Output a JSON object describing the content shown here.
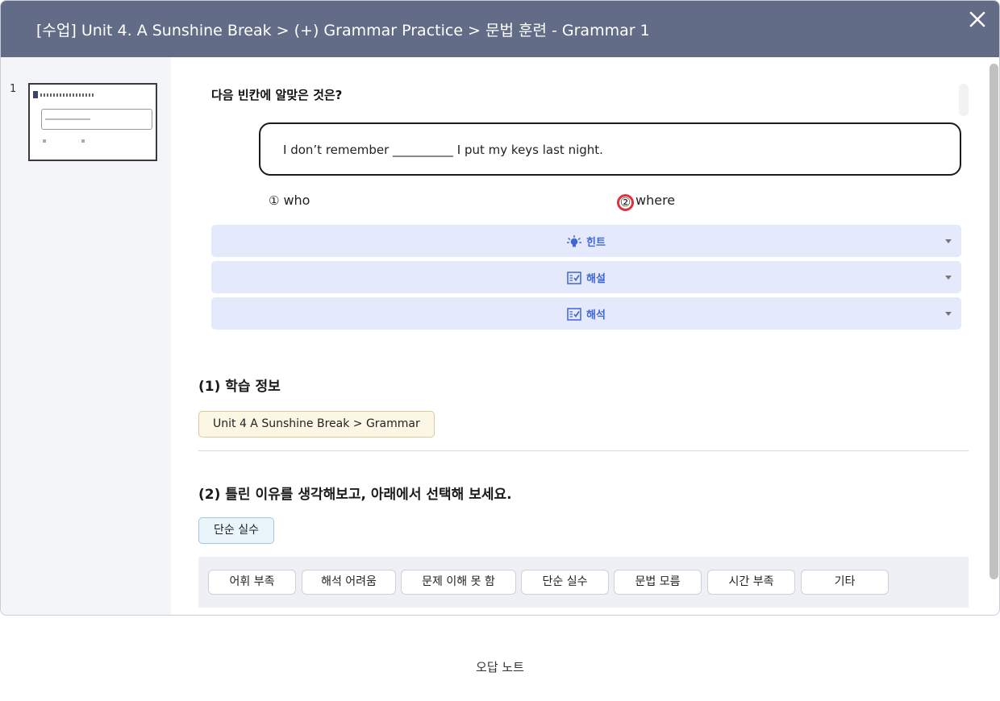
{
  "modal": {
    "title": "[수업] Unit 4. A Sunshine Break > (+) Grammar Practice > 문법 훈련 - Grammar 1",
    "close_icon": "close-icon"
  },
  "thumbnails": [
    {
      "number": "1"
    }
  ],
  "question": {
    "prompt": "다음 빈칸에 알맞은 것은?",
    "sentence": "I don’t remember __________ I put my keys last night.",
    "choices": [
      {
        "num": "①",
        "text": "who"
      },
      {
        "num": "②",
        "text": "where",
        "selected": true
      }
    ]
  },
  "accordions": [
    {
      "label": "힌트",
      "icon": "lightbulb-icon"
    },
    {
      "label": "해설",
      "icon": "checklist-icon"
    },
    {
      "label": "해석",
      "icon": "checklist-icon"
    }
  ],
  "study_info": {
    "title": "(1) 학습 정보",
    "chip": "Unit 4 A Sunshine Break > Grammar"
  },
  "reason": {
    "title": "(2) 틀린 이유를 생각해보고, 아래에서 선택해 보세요.",
    "selected": "단순 실수",
    "options": [
      "어휘 부족",
      "해석 어려움",
      "문제 이해 못 함",
      "단순 실수",
      "문법 모름",
      "시간 부족",
      "기타"
    ]
  },
  "footer": {
    "label": "오답 노트"
  },
  "colors": {
    "header_bg": "#626c86",
    "accordion_bg": "#e4e9fb",
    "accordion_text": "#3f66d4",
    "selected_ring": "#e0303a",
    "info_chip_bg": "#fcf7e5",
    "selected_chip_bg": "#eaf4fb"
  }
}
